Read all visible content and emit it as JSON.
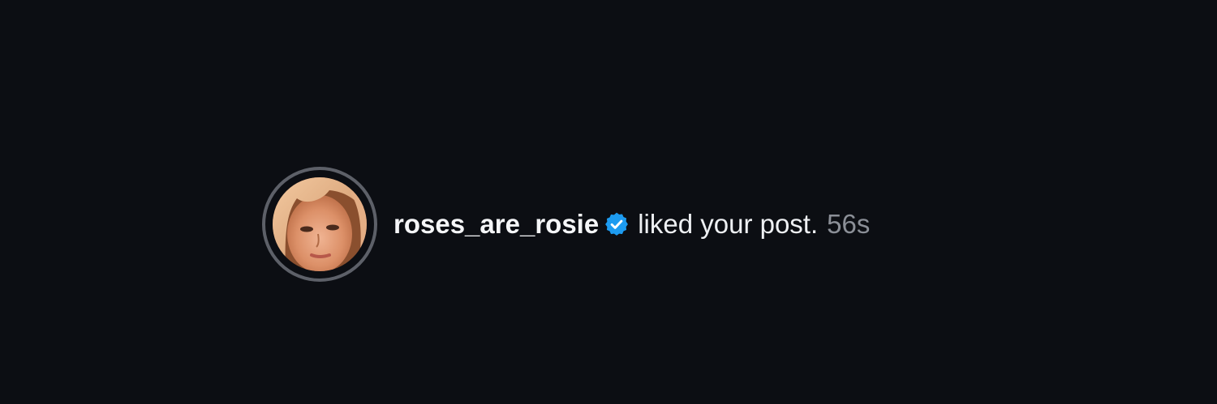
{
  "notification": {
    "username": "roses_are_rosie",
    "verified_icon": "verified-badge-icon",
    "action_text": "liked your post.",
    "timestamp": "56s",
    "avatar_icon": "avatar-photo"
  },
  "colors": {
    "background": "#0c0e13",
    "verified": "#1d9bf0",
    "ring": "#5d6068",
    "timestamp": "#8b8f97"
  }
}
